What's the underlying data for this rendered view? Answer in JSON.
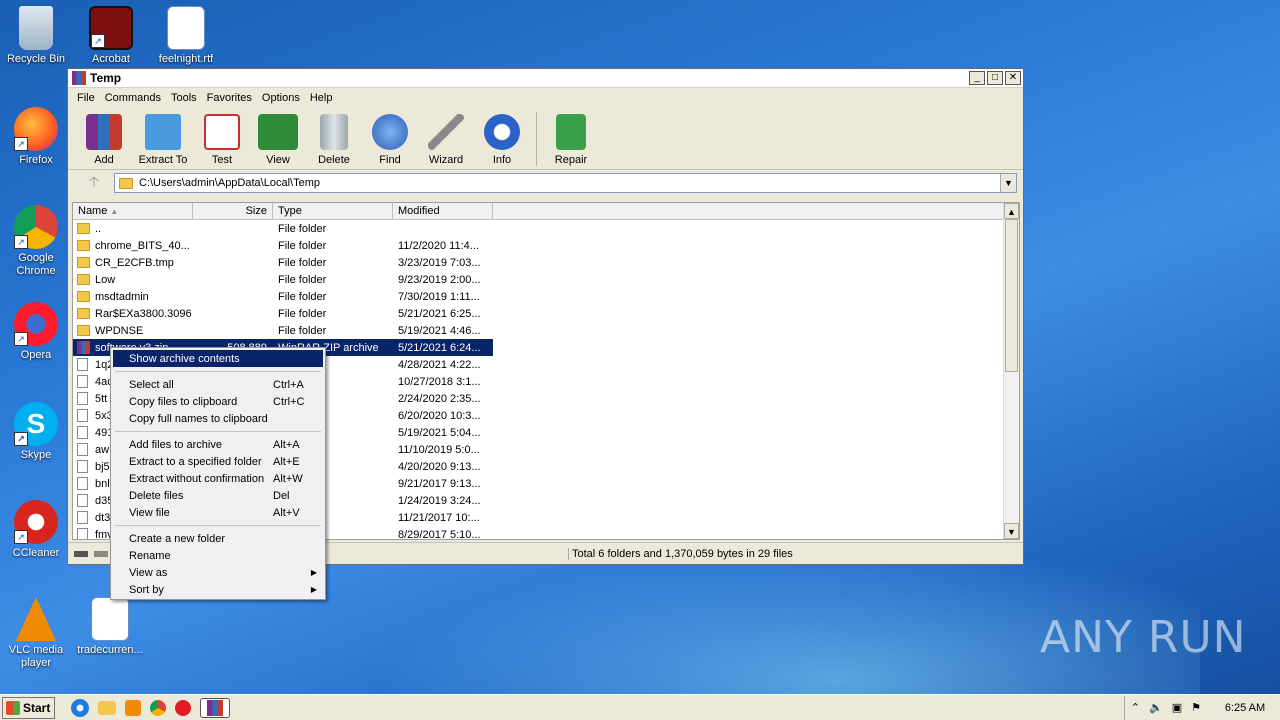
{
  "desktop": {
    "icons": [
      {
        "label": "Recycle Bin"
      },
      {
        "label": "Acrobat"
      },
      {
        "label": "feelnight.rtf"
      },
      {
        "label": "Firefox"
      },
      {
        "label": "Google Chrome"
      },
      {
        "label": "Opera"
      },
      {
        "label": "Skype"
      },
      {
        "label": "CCleaner"
      },
      {
        "label": "VLC media player"
      },
      {
        "label": "tradecurren..."
      }
    ]
  },
  "window": {
    "title": "Temp",
    "menu": [
      "File",
      "Commands",
      "Tools",
      "Favorites",
      "Options",
      "Help"
    ],
    "toolbar": [
      "Add",
      "Extract To",
      "Test",
      "View",
      "Delete",
      "Find",
      "Wizard",
      "Info",
      "Repair"
    ],
    "address": "C:\\Users\\admin\\AppData\\Local\\Temp",
    "columns": [
      "Name",
      "Size",
      "Type",
      "Modified"
    ],
    "rows": [
      {
        "name": "..",
        "size": "",
        "type": "File folder",
        "modified": "",
        "kind": "folder"
      },
      {
        "name": "chrome_BITS_40...",
        "size": "",
        "type": "File folder",
        "modified": "11/2/2020 11:4...",
        "kind": "folder"
      },
      {
        "name": "CR_E2CFB.tmp",
        "size": "",
        "type": "File folder",
        "modified": "3/23/2019 7:03...",
        "kind": "folder"
      },
      {
        "name": "Low",
        "size": "",
        "type": "File folder",
        "modified": "9/23/2019 2:00...",
        "kind": "folder"
      },
      {
        "name": "msdtadmin",
        "size": "",
        "type": "File folder",
        "modified": "7/30/2019 1:11...",
        "kind": "folder"
      },
      {
        "name": "Rar$EXa3800.3096",
        "size": "",
        "type": "File folder",
        "modified": "5/21/2021 6:25...",
        "kind": "folder"
      },
      {
        "name": "WPDNSE",
        "size": "",
        "type": "File folder",
        "modified": "5/19/2021 4:46...",
        "kind": "folder"
      },
      {
        "name": "software v3.zip",
        "size": "508,889",
        "type": "WinRAR ZIP archive",
        "modified": "5/21/2021 6:24...",
        "kind": "zip",
        "selected": true
      },
      {
        "name": "1q2",
        "size": "",
        "type": "",
        "modified": "4/28/2021 4:22...",
        "kind": "file"
      },
      {
        "name": "4ac",
        "size": "",
        "type": "",
        "modified": "10/27/2018 3:1...",
        "kind": "file"
      },
      {
        "name": "5tt",
        "size": "",
        "type": "",
        "modified": "2/24/2020 2:35...",
        "kind": "file"
      },
      {
        "name": "5x3",
        "size": "",
        "type": "",
        "modified": "6/20/2020 10:3...",
        "kind": "file"
      },
      {
        "name": "491",
        "size": "",
        "type": "",
        "modified": "5/19/2021 5:04...",
        "kind": "file"
      },
      {
        "name": "aw",
        "size": "",
        "type": "",
        "modified": "11/10/2019 5:0...",
        "kind": "file"
      },
      {
        "name": "bj5",
        "size": "",
        "type": "",
        "modified": "4/20/2020 9:13...",
        "kind": "file"
      },
      {
        "name": "bnl",
        "size": "",
        "type": "",
        "modified": "9/21/2017 9:13...",
        "kind": "file"
      },
      {
        "name": "d35",
        "size": "",
        "type": "",
        "modified": "1/24/2019 3:24...",
        "kind": "file"
      },
      {
        "name": "dt3",
        "size": "",
        "type": "",
        "modified": "11/21/2017 10:...",
        "kind": "file"
      },
      {
        "name": "fmv",
        "size": "",
        "type": "",
        "modified": "8/29/2017 5:10...",
        "kind": "file"
      }
    ],
    "status": "Total 6 folders and 1,370,059 bytes in 29 files"
  },
  "context_menu": [
    {
      "label": "Show archive contents",
      "shortcut": "",
      "highlight": true
    },
    {
      "sep": true
    },
    {
      "label": "Select all",
      "shortcut": "Ctrl+A"
    },
    {
      "label": "Copy files to clipboard",
      "shortcut": "Ctrl+C"
    },
    {
      "label": "Copy full names to clipboard",
      "shortcut": ""
    },
    {
      "sep": true
    },
    {
      "label": "Add files to archive",
      "shortcut": "Alt+A"
    },
    {
      "label": "Extract to a specified folder",
      "shortcut": "Alt+E"
    },
    {
      "label": "Extract without confirmation",
      "shortcut": "Alt+W"
    },
    {
      "label": "Delete files",
      "shortcut": "Del"
    },
    {
      "label": "View file",
      "shortcut": "Alt+V"
    },
    {
      "sep": true
    },
    {
      "label": "Create a new folder",
      "shortcut": ""
    },
    {
      "label": "Rename",
      "shortcut": ""
    },
    {
      "label": "View as",
      "shortcut": "",
      "submenu": true
    },
    {
      "label": "Sort by",
      "shortcut": "",
      "submenu": true
    }
  ],
  "taskbar": {
    "start_label": "Start",
    "clock": "6:25 AM"
  },
  "watermark": "ANY RUN"
}
